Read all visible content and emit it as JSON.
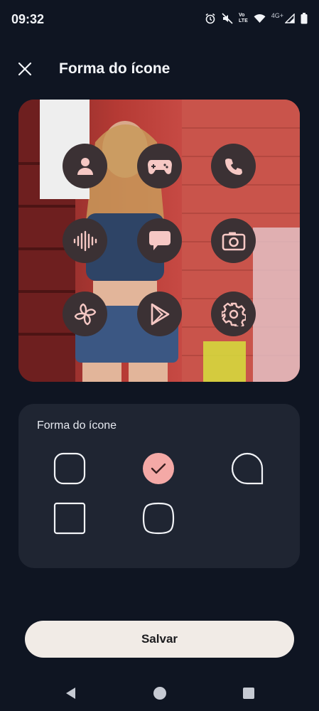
{
  "status_bar": {
    "time": "09:32",
    "lte_top": "Vo",
    "lte_bottom": "LTE",
    "network": "4G+"
  },
  "header": {
    "title": "Forma do ícone",
    "close_icon": "close-icon"
  },
  "preview": {
    "icons": [
      "contacts-icon",
      "gamepad-icon",
      "phone-icon",
      "voice-recorder-icon",
      "messages-icon",
      "camera-icon",
      "pinwheel-icon",
      "play-store-icon",
      "settings-icon"
    ]
  },
  "options": {
    "title": "Forma do ícone",
    "shapes": [
      "rounded-square",
      "circle-selected",
      "teardrop",
      "square",
      "squircle"
    ],
    "selected_index": 1
  },
  "actions": {
    "save_label": "Salvar"
  },
  "colors": {
    "background": "#0f1522",
    "card": "#1f2532",
    "accent": "#f4a9a6",
    "button_bg": "#f1ebe6",
    "icon_bubble": "#3b3134",
    "icon_glyph": "#f6c8c4"
  }
}
